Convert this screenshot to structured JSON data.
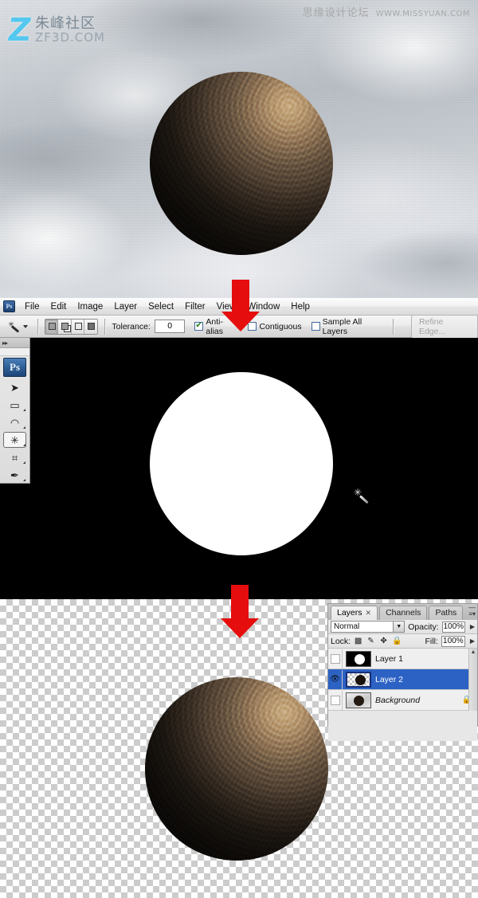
{
  "watermarks": {
    "left_logo": "Z",
    "left_cn": "朱峰社区",
    "left_en": "ZF3D.COM",
    "right_cn": "思缘设计论坛",
    "right_en": "WWW.MISSYUAN.COM"
  },
  "menubar": {
    "app_badge": "Ps",
    "items": [
      {
        "label": "File"
      },
      {
        "label": "Edit"
      },
      {
        "label": "Image"
      },
      {
        "label": "Layer"
      },
      {
        "label": "Select"
      },
      {
        "label": "Filter"
      },
      {
        "label": "View"
      },
      {
        "label": "Window"
      },
      {
        "label": "Help"
      }
    ]
  },
  "options_bar": {
    "active_tool": "magic-wand",
    "selection_modes": [
      "new-selection",
      "add-to-selection",
      "subtract-from-selection",
      "intersect-with-selection"
    ],
    "tolerance_label": "Tolerance:",
    "tolerance_value": "0",
    "anti_alias_label": "Anti-alias",
    "anti_alias_checked": true,
    "contiguous_label": "Contiguous",
    "contiguous_checked": false,
    "sample_all_layers_label": "Sample All Layers",
    "sample_all_layers_checked": false,
    "refine_edge_label": "Refine Edge...",
    "refine_edge_enabled": false
  },
  "toolbar": {
    "expand_glyph": "▸▸",
    "app_badge": "Ps",
    "tools": [
      {
        "name": "move-tool",
        "glyph": "➤"
      },
      {
        "name": "rectangular-marquee-tool",
        "glyph": "▭"
      },
      {
        "name": "lasso-tool",
        "glyph": "◠"
      },
      {
        "name": "magic-wand-tool",
        "glyph": "✳",
        "selected": true
      },
      {
        "name": "crop-tool",
        "glyph": "⌗"
      },
      {
        "name": "eyedropper-tool",
        "glyph": "✒"
      }
    ]
  },
  "canvas": {
    "step1_caption": "sphere photo on cloudy sky background",
    "step2_caption": "white circle selection mask on black",
    "step3_caption": "extracted sphere on transparent checkerboard",
    "cursor": "magic-wand-cursor"
  },
  "layers_panel": {
    "tabs": [
      {
        "label": "Layers",
        "active": true,
        "closable": true
      },
      {
        "label": "Channels",
        "active": false,
        "closable": false
      },
      {
        "label": "Paths",
        "active": false,
        "closable": false
      }
    ],
    "blend_mode": "Normal",
    "opacity_label": "Opacity:",
    "opacity_value": "100%",
    "lock_label": "Lock:",
    "lock_icons": [
      "lock-transparency",
      "lock-image-pixels",
      "lock-position",
      "lock-all"
    ],
    "fill_label": "Fill:",
    "fill_value": "100%",
    "layers": [
      {
        "name": "Layer 1",
        "visible": false,
        "selected": false,
        "locked": false,
        "thumb": "black-bg",
        "italic": false
      },
      {
        "name": "Layer 2",
        "visible": true,
        "selected": true,
        "locked": false,
        "thumb": "checker-bg",
        "italic": false
      },
      {
        "name": "Background",
        "visible": false,
        "selected": false,
        "locked": true,
        "thumb": "sky-bg",
        "italic": true
      }
    ],
    "eye_glyph": "👁",
    "lock_glyph": "🔒"
  },
  "annotations": {
    "arrow_1_target": "contiguous-checkbox",
    "arrow_2_target": "transparent-result",
    "arrow_color": "#e50d0d"
  }
}
